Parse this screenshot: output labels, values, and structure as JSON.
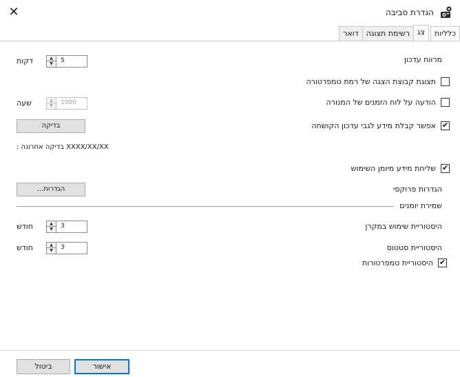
{
  "window": {
    "title": "הגדרת סביבה",
    "close_glyph": "✕",
    "icon": "settings-app-icon"
  },
  "tabs": [
    {
      "label": "כלליות",
      "active": false
    },
    {
      "label": "צג",
      "active": true
    },
    {
      "label": "רשימת תצוגה",
      "active": false
    },
    {
      "label": "דואר",
      "active": false
    }
  ],
  "monitor": {
    "update_interval": {
      "label": "מרווח עדכון",
      "value": "5",
      "unit": "דקות"
    },
    "show_temp_level_group": {
      "label": "תצוגת קבוצת הצגה של רמת טמפרטורה",
      "checked": false
    },
    "lamp_schedule_notice": {
      "label": "הודעה על לוח הזמנים של המנורה",
      "checked": false,
      "value": "1000",
      "unit": "שעה"
    },
    "receive_update_info": {
      "label": "אפשר קבלת מידע לגבי עדכון הקושחה",
      "checked": true
    },
    "check_button": "בדיקה",
    "last_check_label": "בדיקה אחרונה :",
    "last_check_value": "XXXX/XX/XX",
    "send_usage_info": {
      "label": "שליחת מידע מיומן השימוש",
      "checked": true
    },
    "proxy_label": "הגדרות פרוקסי",
    "proxy_button": "הגדרות..."
  },
  "log_section": {
    "title": "שמירת יומנים",
    "projector_usage_history": {
      "label": "היסטוריית שימוש במקרן",
      "value": "3",
      "unit": "חודש"
    },
    "status_history": {
      "label": "היסטוריית סטטוס",
      "value": "3",
      "unit": "חודש"
    },
    "temperature_history": {
      "label": "היסטוריית טמפרטורות",
      "checked": true
    }
  },
  "footer": {
    "ok": "אישור",
    "cancel": "ביטול"
  }
}
